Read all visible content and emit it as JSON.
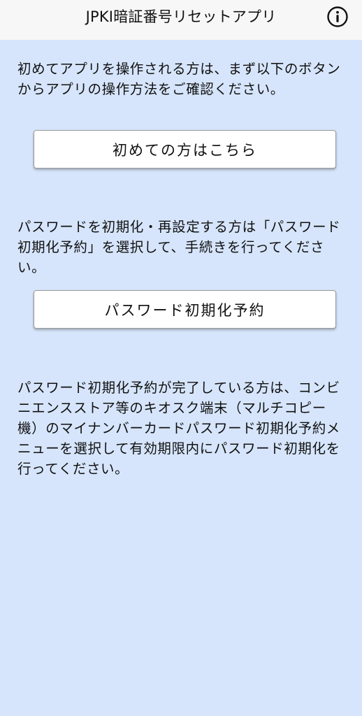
{
  "header": {
    "title": "JPKI暗証番号リセットアプリ",
    "info_icon": "info-circle-icon"
  },
  "sections": [
    {
      "text": "初めてアプリを操作される方は、まず以下のボタンからアプリの操作方法をご確認ください。",
      "button_label": "初めての方はこちら"
    },
    {
      "text": "パスワードを初期化・再設定する方は「パスワード初期化予約」を選択して、手続きを行ってください。",
      "button_label": "パスワード初期化予約"
    },
    {
      "text": "パスワード初期化予約が完了している方は、コンビニエンスストア等のキオスク端末（マルチコピー機）のマイナンバーカードパスワード初期化予約メニューを選択して有効期限内にパスワード初期化を行ってください。"
    }
  ],
  "colors": {
    "background": "#d6e5fb",
    "header_background": "#f7f7f7",
    "button_background": "#ffffff"
  }
}
